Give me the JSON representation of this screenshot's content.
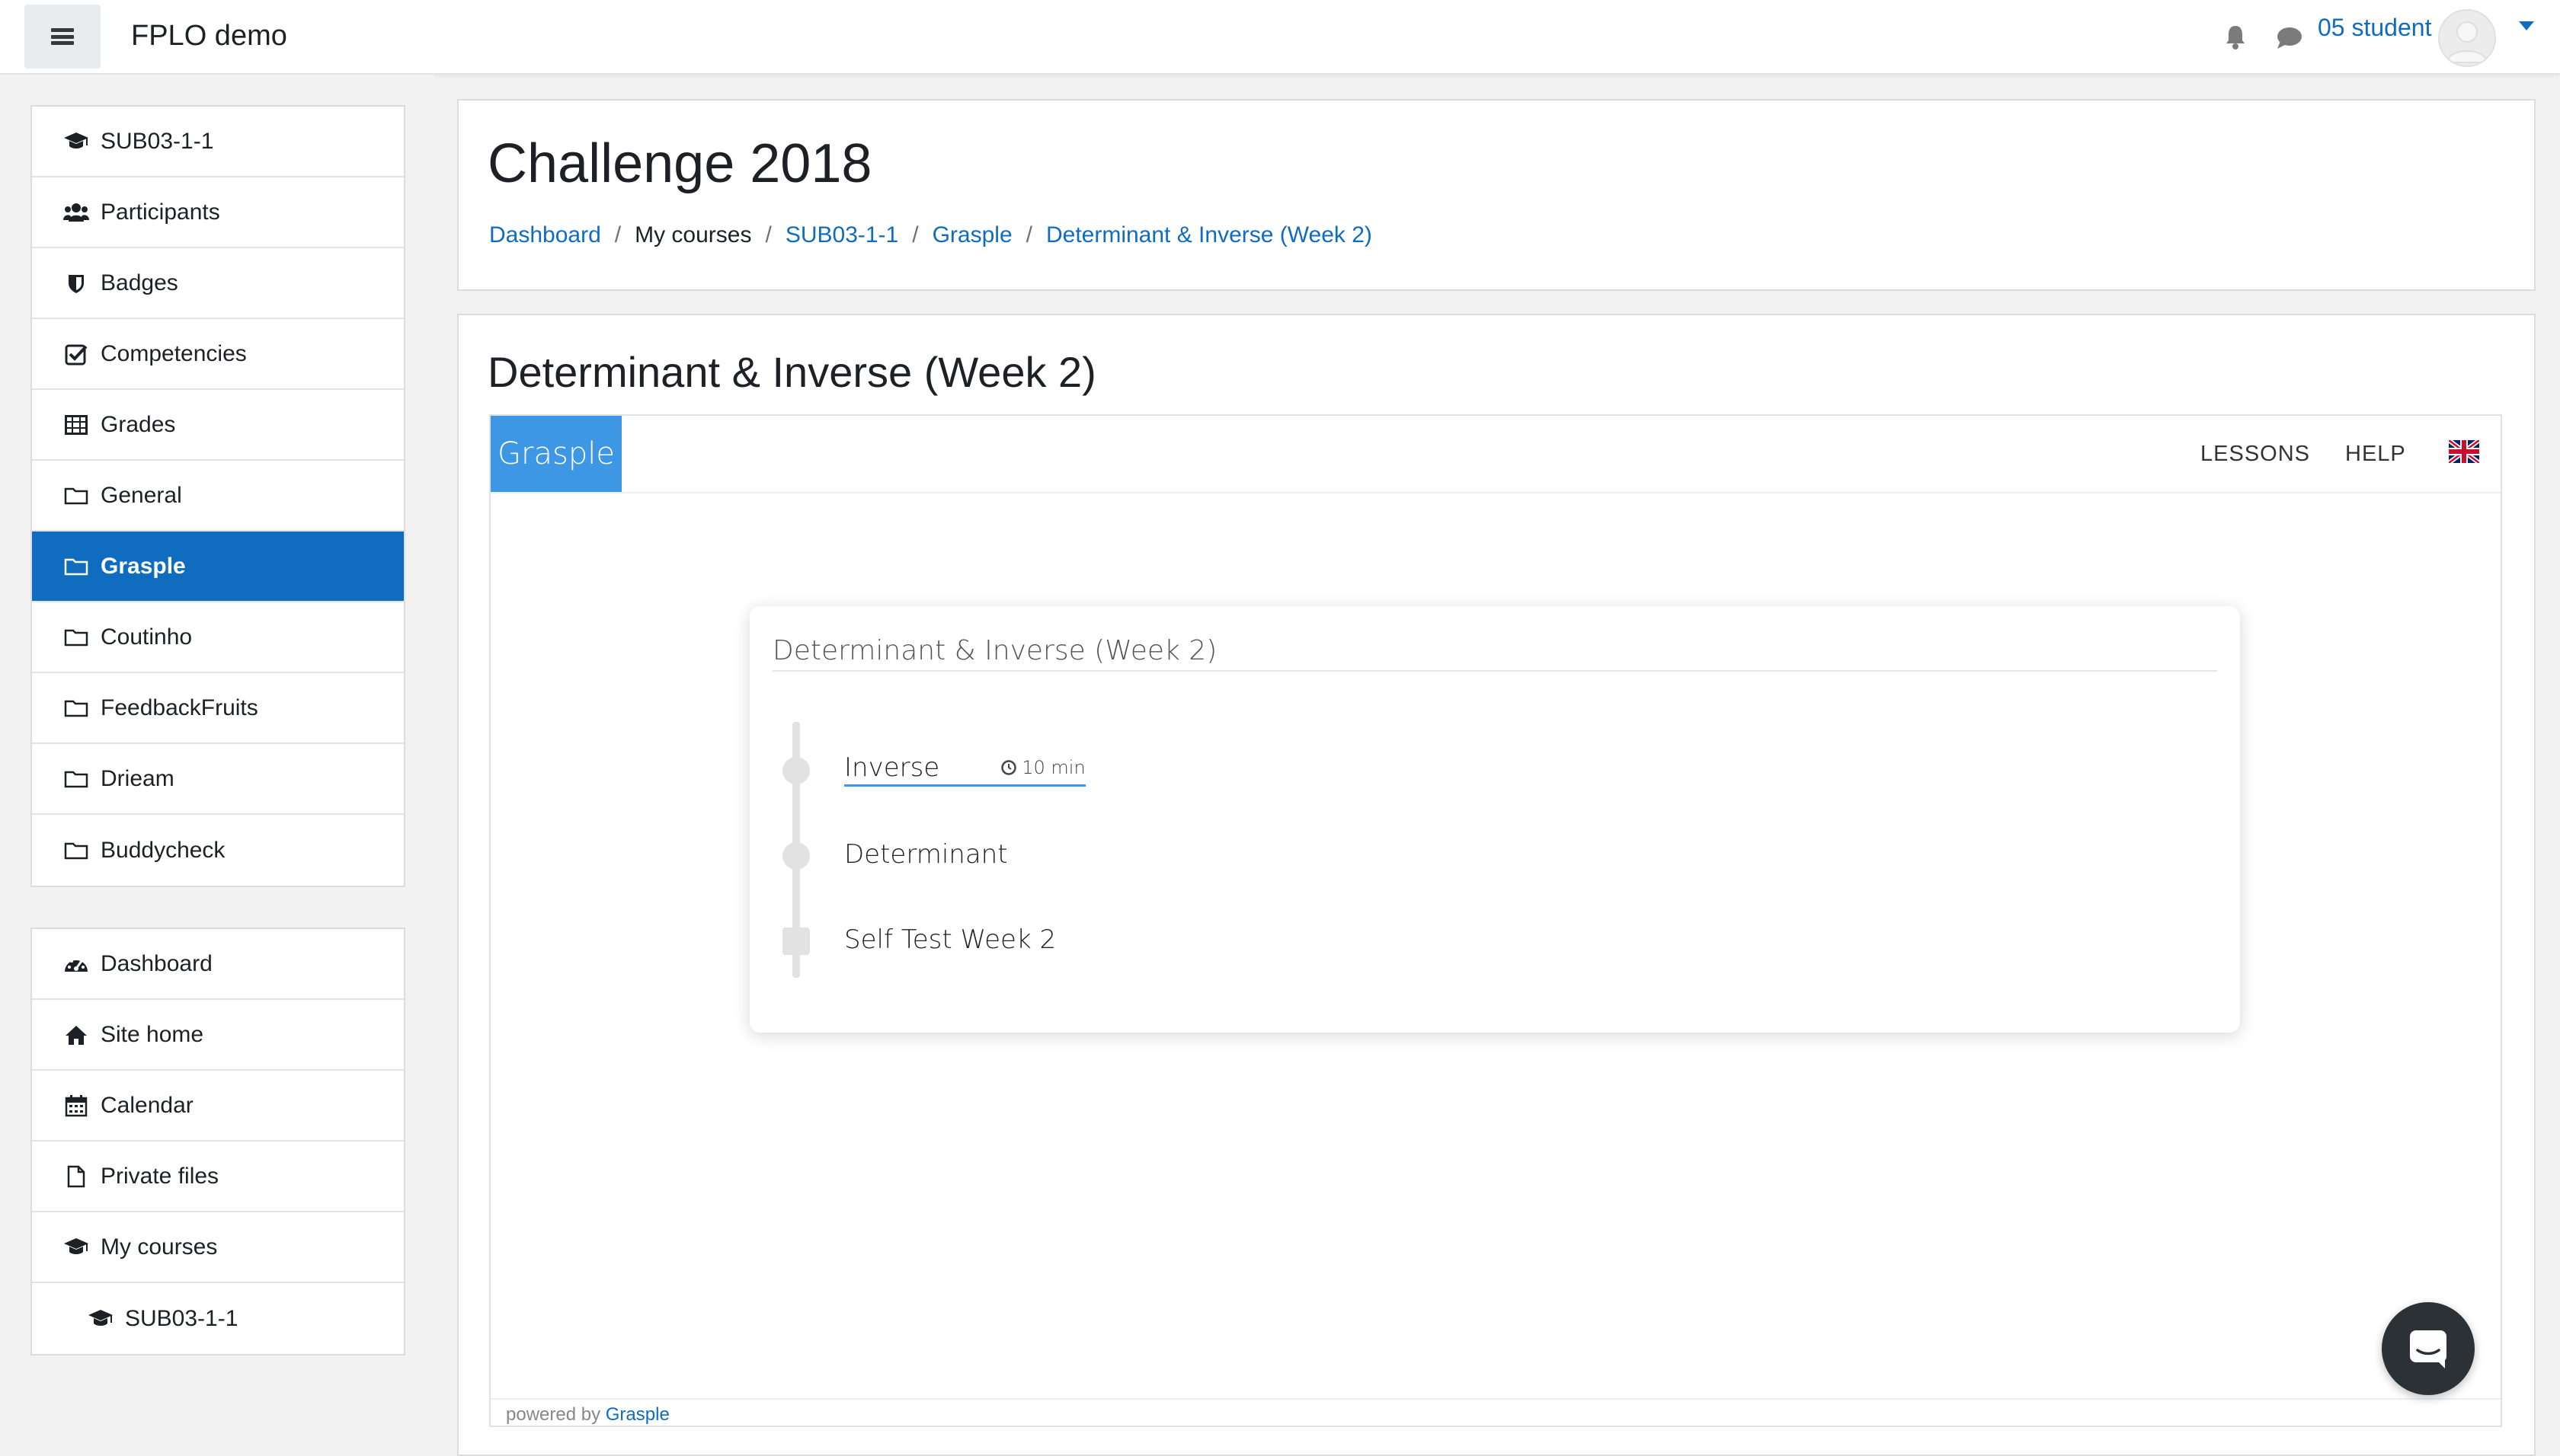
{
  "navbar": {
    "brand": "FPLO demo",
    "user_name": "05 student"
  },
  "drawer": {
    "course_items": [
      {
        "label": "SUB03-1-1",
        "icon": "graduation-cap-icon"
      },
      {
        "label": "Participants",
        "icon": "users-icon"
      },
      {
        "label": "Badges",
        "icon": "shield-icon"
      },
      {
        "label": "Competencies",
        "icon": "check-square-icon"
      },
      {
        "label": "Grades",
        "icon": "table-icon"
      },
      {
        "label": "General",
        "icon": "folder-icon"
      },
      {
        "label": "Grasple",
        "icon": "folder-icon",
        "active": true
      },
      {
        "label": "Coutinho",
        "icon": "folder-icon"
      },
      {
        "label": "FeedbackFruits",
        "icon": "folder-icon"
      },
      {
        "label": "Drieam",
        "icon": "folder-icon"
      },
      {
        "label": "Buddycheck",
        "icon": "folder-icon"
      }
    ],
    "site_items": [
      {
        "label": "Dashboard",
        "icon": "dashboard-icon"
      },
      {
        "label": "Site home",
        "icon": "home-icon"
      },
      {
        "label": "Calendar",
        "icon": "calendar-icon"
      },
      {
        "label": "Private files",
        "icon": "file-icon"
      },
      {
        "label": "My courses",
        "icon": "graduation-cap-icon"
      },
      {
        "label": "SUB03-1-1",
        "icon": "graduation-cap-icon"
      }
    ]
  },
  "header": {
    "title": "Challenge 2018",
    "breadcrumb": [
      "Dashboard",
      "My courses",
      "SUB03-1-1",
      "Grasple",
      "Determinant & Inverse (Week 2)"
    ]
  },
  "activity": {
    "title": "Determinant & Inverse (Week 2)",
    "grasple": {
      "logo": "Grasple",
      "menu": [
        "LESSONS",
        "HELP"
      ],
      "language_icon": "uk-flag-icon",
      "card_title": "Determinant & Inverse (Week 2)",
      "lessons": [
        {
          "name": "Inverse",
          "duration": "10 min"
        },
        {
          "name": "Determinant"
        },
        {
          "name": "Self Test Week 2"
        }
      ],
      "footer_prefix": "powered by",
      "footer_link": "Grasple"
    }
  },
  "colors": {
    "accent": "#0f6cbf",
    "grasple_blue": "#3d97e5",
    "background": "#f2f2f2"
  }
}
